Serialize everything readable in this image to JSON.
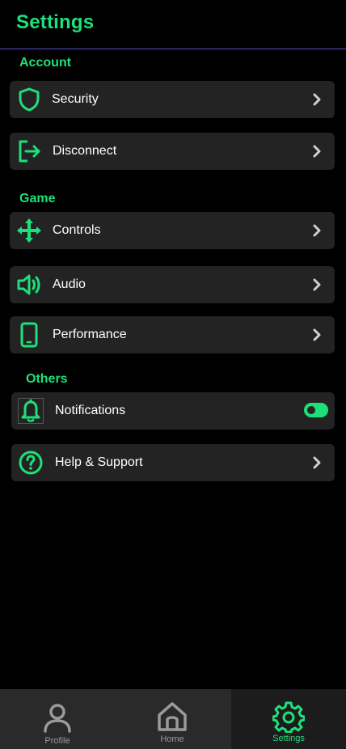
{
  "header": {
    "title": "Settings"
  },
  "colors": {
    "accent": "#1ee07a",
    "row_bg": "#232323",
    "divider": "#5a4fd0",
    "tabbar_bg": "#2a2a2a",
    "muted": "#9a9a9a"
  },
  "sections": {
    "account": {
      "title": "Account",
      "items": [
        {
          "label": "Security",
          "icon": "shield-icon"
        },
        {
          "label": "Disconnect",
          "icon": "logout-icon"
        }
      ]
    },
    "game": {
      "title": "Game",
      "items": [
        {
          "label": "Controls",
          "icon": "move-arrows-icon"
        },
        {
          "label": "Audio",
          "icon": "speaker-icon"
        },
        {
          "label": "Performance",
          "icon": "phone-icon"
        }
      ]
    },
    "others": {
      "title": "Others",
      "items": [
        {
          "label": "Notifications",
          "icon": "bell-icon",
          "toggle_on": true
        },
        {
          "label": "Help & Support",
          "icon": "help-circle-icon"
        }
      ]
    }
  },
  "tabbar": {
    "tabs": [
      {
        "label": "Profile",
        "icon": "user-icon",
        "active": false
      },
      {
        "label": "Home",
        "icon": "home-icon",
        "active": false
      },
      {
        "label": "Settings",
        "icon": "gear-icon",
        "active": true
      }
    ]
  }
}
